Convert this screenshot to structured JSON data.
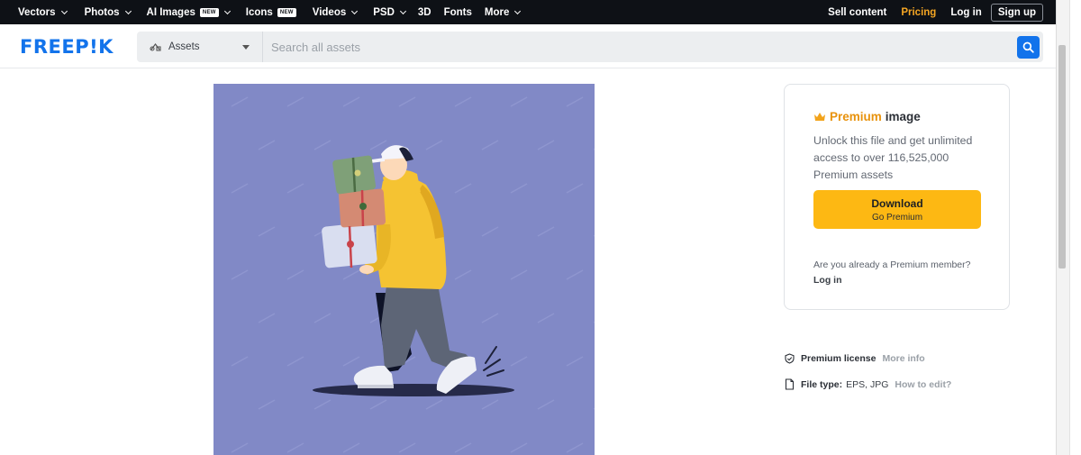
{
  "topnav": {
    "items": [
      {
        "label": "Vectors",
        "dropdown": true
      },
      {
        "label": "Photos",
        "dropdown": true
      },
      {
        "label": "AI Images",
        "badge": "NEW",
        "dropdown": true
      },
      {
        "label": "Icons",
        "badge": "NEW",
        "dropdown": false
      },
      {
        "label": "Videos",
        "dropdown": true
      },
      {
        "label": "PSD",
        "dropdown": true
      },
      {
        "label": "3D",
        "dropdown": false
      },
      {
        "label": "Fonts",
        "dropdown": false
      },
      {
        "label": "More",
        "dropdown": true
      }
    ],
    "right": {
      "sell": "Sell content",
      "pricing": "Pricing",
      "login": "Log in",
      "signup": "Sign up"
    }
  },
  "header": {
    "logo": "FREEP!K",
    "asset_select": "Assets",
    "search_placeholder": "Search all assets"
  },
  "card": {
    "premium_word": "Premium",
    "image_word": "image",
    "description": "Unlock this file and get unlimited access to over 116,525,000 Premium assets",
    "download_label": "Download",
    "download_sub": "Go Premium",
    "already_member": "Are you already a Premium member?",
    "login": "Log in"
  },
  "meta": {
    "license_label": "Premium license",
    "license_link": "More info",
    "filetype_label": "File type:",
    "filetype_value": "EPS, JPG",
    "filetype_link": "How to edit?"
  },
  "colors": {
    "nav_bg": "#0e1116",
    "brand_blue": "#1273eb",
    "pricing_orange": "#f5a623",
    "premium_orange": "#e8920c",
    "download_yellow": "#fdb813",
    "illustration_bg": "#8189c6"
  }
}
